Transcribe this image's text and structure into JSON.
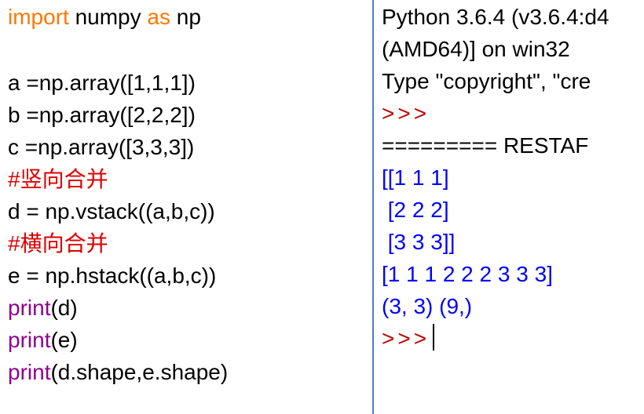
{
  "editor": {
    "lines": [
      {
        "t1": "import",
        "t2": " numpy ",
        "t3": "as",
        "t4": " np"
      },
      {
        "text": "a =np.array([1,1,1])"
      },
      {
        "text": "b =np.array([2,2,2])"
      },
      {
        "text": "c =np.array([3,3,3])"
      },
      {
        "comment": "#竖向合并"
      },
      {
        "text": "d = np.vstack((a,b,c))"
      },
      {
        "comment": "#横向合并"
      },
      {
        "text": "e = np.hstack((a,b,c))"
      },
      {
        "fn": "print",
        "args": "(d)"
      },
      {
        "fn": "print",
        "args": "(e)"
      },
      {
        "fn": "print",
        "args": "(d.shape,e.shape)"
      }
    ]
  },
  "shell": {
    "lines": [
      "Python 3.6.4 (v3.6.4:d4",
      "(AMD64)] on win32",
      "Type \"copyright\", \"cre",
      ">>>",
      "========= RESTAF",
      "[[1 1 1]",
      " [2 2 2]",
      " [3 3 3]]",
      "[1 1 1 2 2 2 3 3 3]",
      "(3, 3) (9,)",
      ">>>"
    ]
  },
  "colors": {
    "keyword": "#ff7700",
    "builtin": "#900090",
    "comment": "#dd0000",
    "output": "#0000ff",
    "prompt": "#c00000",
    "divider": "#4f7fbf"
  }
}
